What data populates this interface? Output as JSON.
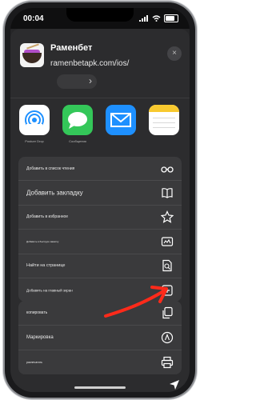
{
  "status": {
    "time": "00:04"
  },
  "header": {
    "title": "Раменбет",
    "url": "ramenbetapk.com/ios/",
    "options_chevron": "›",
    "close_glyph": "×"
  },
  "apps": [
    {
      "name": "AirDrop",
      "label": "Posture Drop"
    },
    {
      "name": "Messages",
      "label": "Сообщения"
    },
    {
      "name": "Mail",
      "label": ""
    },
    {
      "name": "Notes",
      "label": ""
    }
  ],
  "actions_group1": [
    {
      "label": "Добавить в список чтения",
      "icon": "glasses-icon"
    },
    {
      "label": "Добавить закладку",
      "icon": "book-icon"
    },
    {
      "label": "Добавить в избранное",
      "icon": "star-icon"
    },
    {
      "label": "Добавить в быструю заметку",
      "icon": "quick-note-icon"
    },
    {
      "label": "Найти на странице",
      "icon": "find-on-page-icon"
    },
    {
      "label": "Добавить на главный экран",
      "icon": "add-to-home-icon"
    }
  ],
  "actions_group2": [
    {
      "label": "копировать",
      "icon": "copy-icon"
    },
    {
      "label": "Маркировка",
      "icon": "markup-icon"
    },
    {
      "label": "распечатать",
      "icon": "print-icon"
    }
  ],
  "colors": {
    "sheet_bg": "#2c2c2e",
    "row_bg": "#3a3a3c",
    "arrow": "#ff2a1a"
  }
}
